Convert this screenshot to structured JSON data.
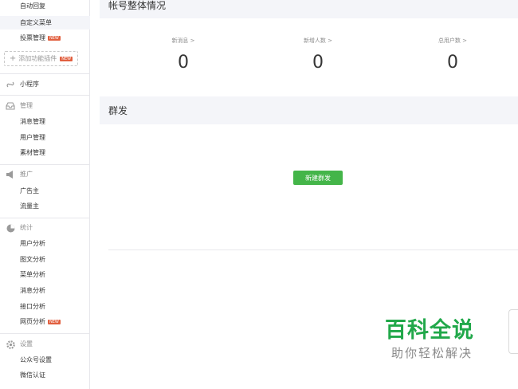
{
  "sidebar": {
    "top_items": [
      {
        "label": "自动回复"
      },
      {
        "label": "自定义菜单"
      },
      {
        "label": "投票管理",
        "badge": "NEW"
      }
    ],
    "add_plugin": "添加功能插件",
    "add_plugin_badge": "NEW",
    "mini_program": "小程序",
    "manage": {
      "label": "管理",
      "items": [
        "消息管理",
        "用户管理",
        "素材管理"
      ]
    },
    "promote": {
      "label": "推广",
      "items": [
        "广告主",
        "流量主"
      ]
    },
    "stats": {
      "label": "统计",
      "items": [
        "用户分析",
        "图文分析",
        "菜单分析",
        "消息分析",
        "接口分析",
        "网页分析"
      ],
      "badge": "NEW"
    },
    "settings": {
      "label": "设置",
      "items": [
        "公众号设置",
        "微信认证"
      ]
    }
  },
  "main": {
    "overview_title": "帐号整体情况",
    "stats": [
      {
        "label": "新消息",
        "value": "0"
      },
      {
        "label": "新增人数",
        "value": "0"
      },
      {
        "label": "总用户数",
        "value": "0"
      }
    ],
    "broadcast_title": "群发",
    "new_broadcast_button": "新建群发"
  },
  "watermark": {
    "line1": "百科全说",
    "line2": "助你轻松解决"
  },
  "colors": {
    "accent": "#44b549",
    "badge": "#e15f3f",
    "section_bg": "#f4f5f9",
    "watermark": "#21a84a"
  }
}
